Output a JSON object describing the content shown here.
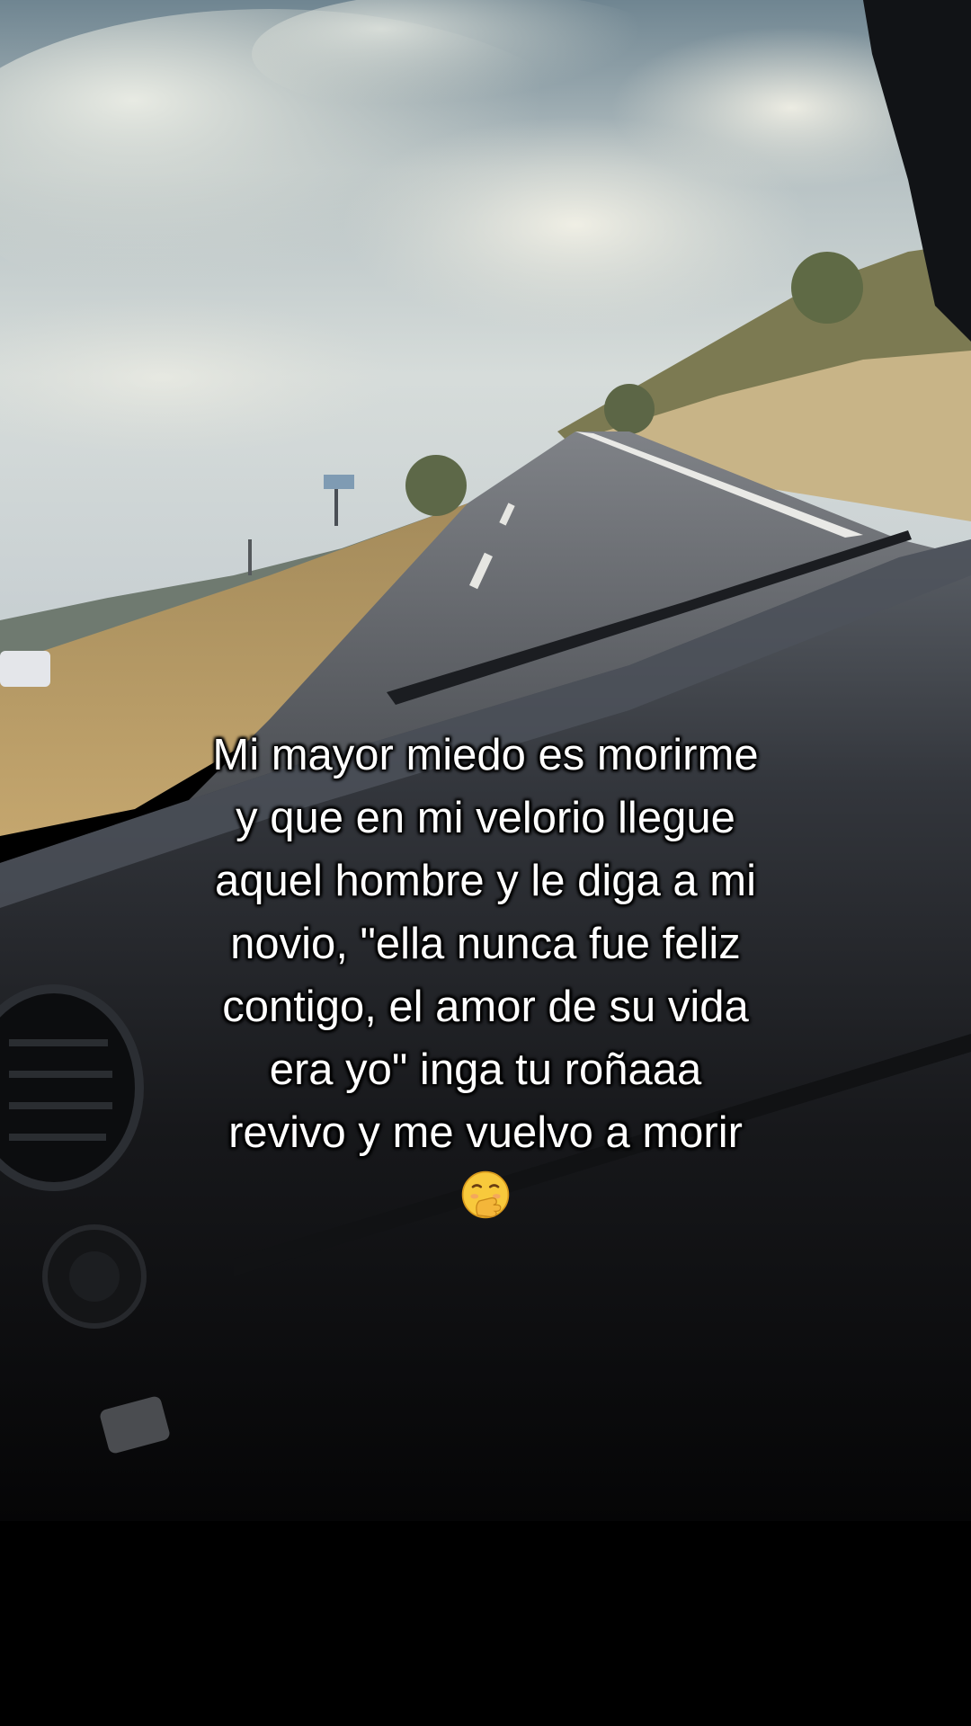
{
  "caption": {
    "lines": [
      "Mi mayor miedo es morirme",
      "y que en mi velorio llegue",
      "aquel hombre y le diga a mi",
      "novio, \"ella nunca fue feliz",
      "contigo, el amor de su vida",
      "era yo\" inga tu roñaaa",
      "revivo y me vuelvo a morir"
    ],
    "emoji": "hand-over-mouth-face-icon"
  },
  "scene": {
    "description_icon": "car-dashboard-road-photo",
    "colors": {
      "sky": "#c9d3d6",
      "road": "#4a4d52",
      "dashboard": "#1a1c20",
      "grass": "#b49a66"
    }
  }
}
